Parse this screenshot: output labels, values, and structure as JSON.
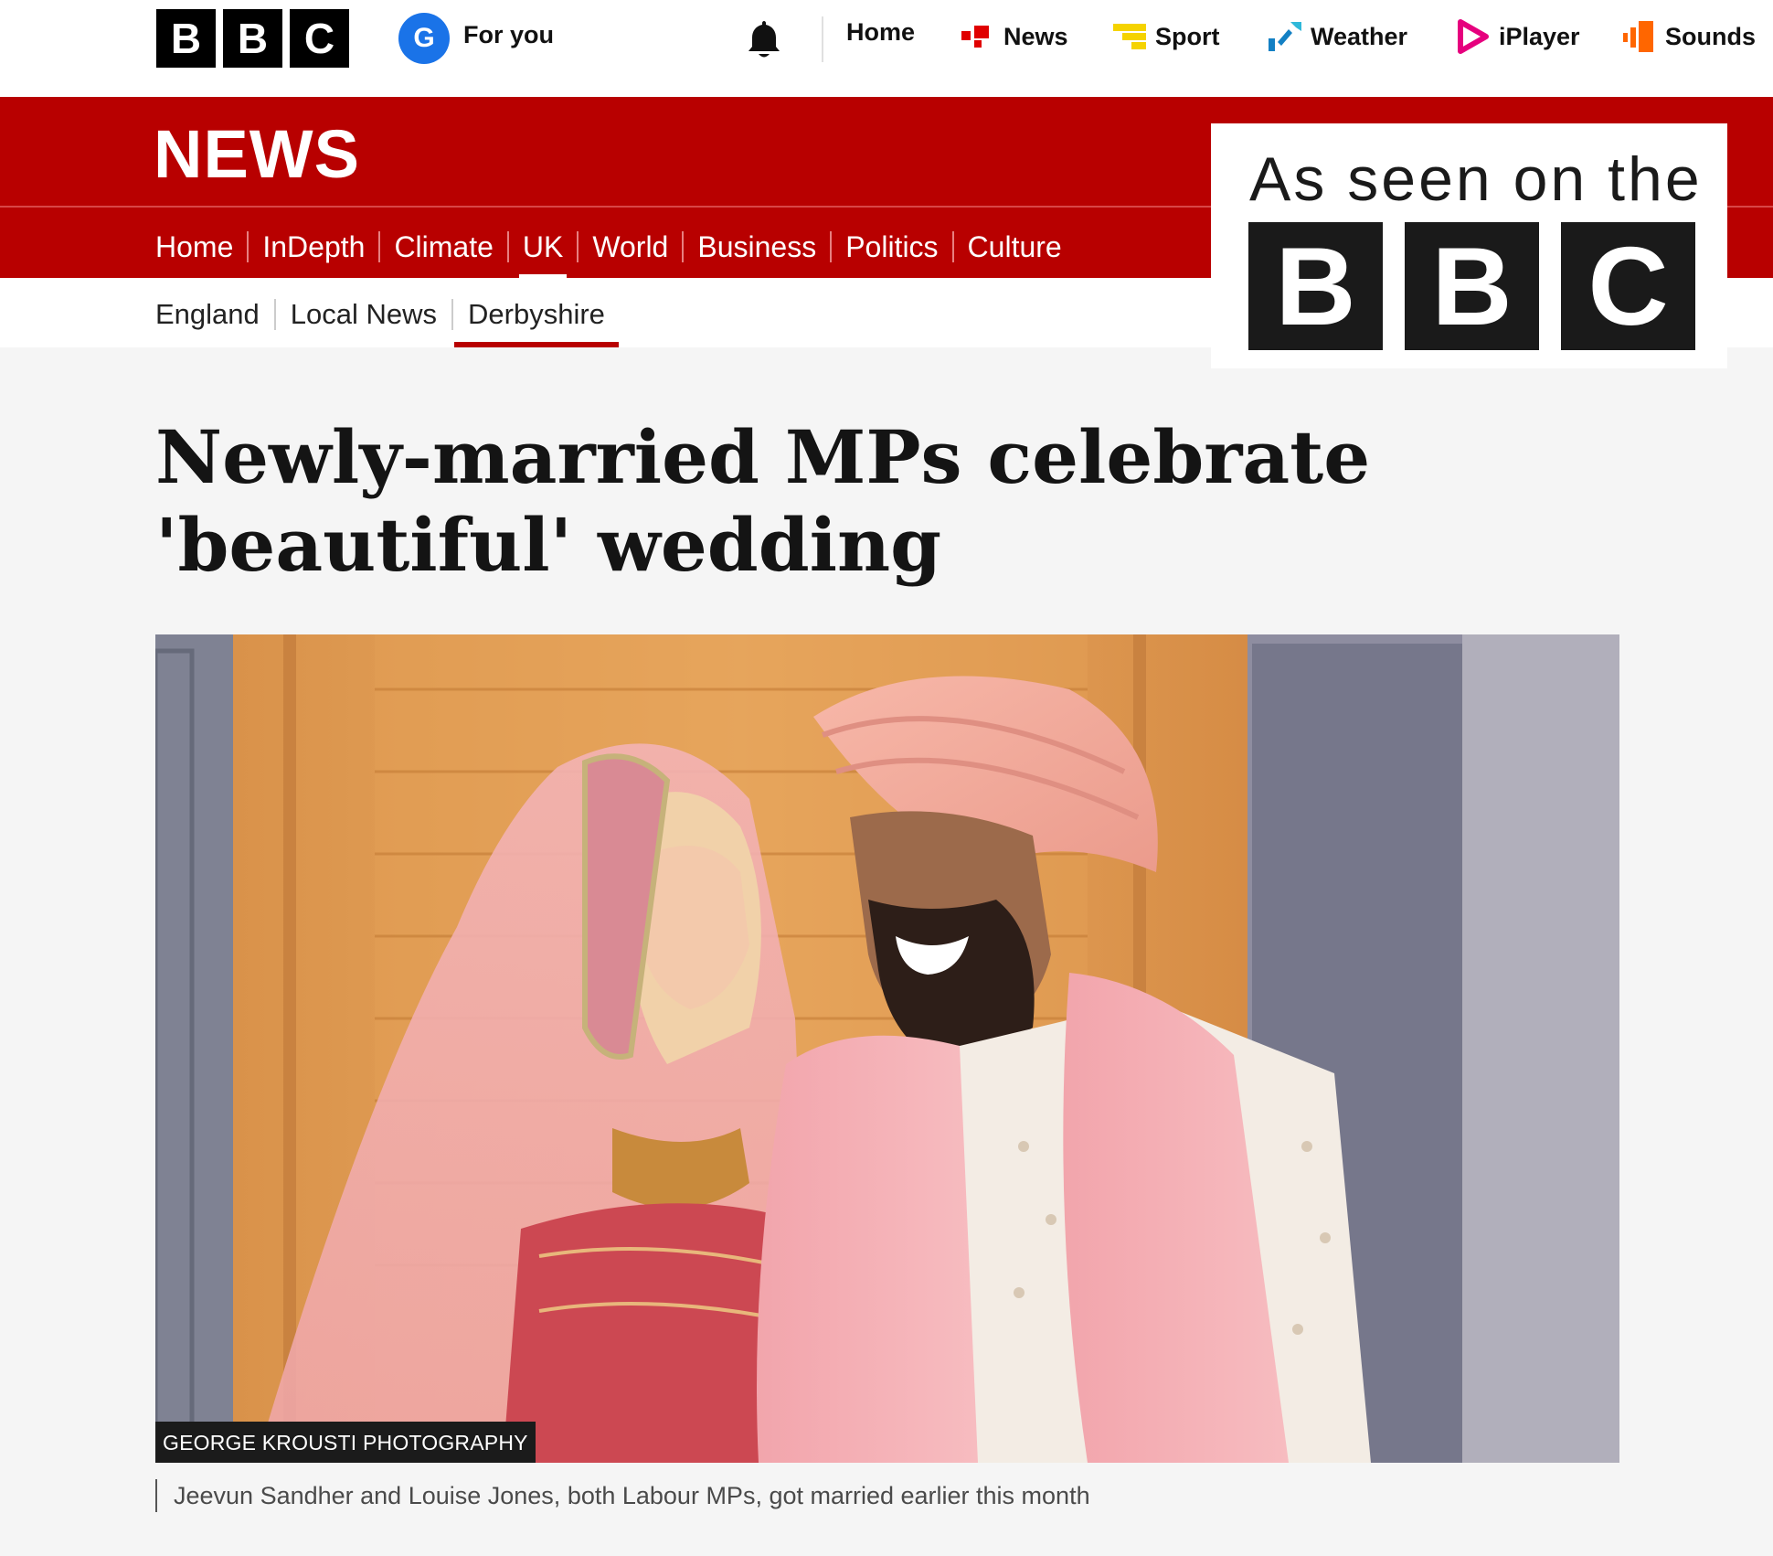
{
  "topbar": {
    "logo_letters": [
      "B",
      "B",
      "C"
    ],
    "g_letter": "G",
    "for_you": "For you",
    "nav": [
      {
        "label": "Home",
        "icon": "none"
      },
      {
        "label": "News",
        "icon": "news-icon"
      },
      {
        "label": "Sport",
        "icon": "sport-icon"
      },
      {
        "label": "Weather",
        "icon": "weather-icon"
      },
      {
        "label": "iPlayer",
        "icon": "iplayer-icon"
      },
      {
        "label": "Sounds",
        "icon": "sounds-icon"
      }
    ]
  },
  "newsbar": {
    "title": "NEWS",
    "sections": [
      "Home",
      "InDepth",
      "Climate",
      "UK",
      "World",
      "Business",
      "Politics",
      "Culture"
    ],
    "active_section": "UK"
  },
  "subnav": {
    "items": [
      "England",
      "Local News",
      "Derbyshire"
    ],
    "active_item": "Derbyshire"
  },
  "badge": {
    "text": "As seen on the",
    "letters": [
      "B",
      "B",
      "C"
    ]
  },
  "article": {
    "headline_line1": "Newly-married MPs celebrate",
    "headline_line2": "'beautiful' wedding",
    "image_credit": "GEORGE KROUSTI PHOTOGRAPHY",
    "caption": "Jeevun Sandher and Louise Jones, both Labour MPs, got married earlier this month"
  },
  "colors": {
    "brand_red": "#b80000",
    "news_icon": "#e00000",
    "sport_icon": "#f5d300",
    "weather_icon": "#1380c4",
    "iplayer_icon": "#e6007e",
    "sounds_icon": "#ff6600"
  }
}
